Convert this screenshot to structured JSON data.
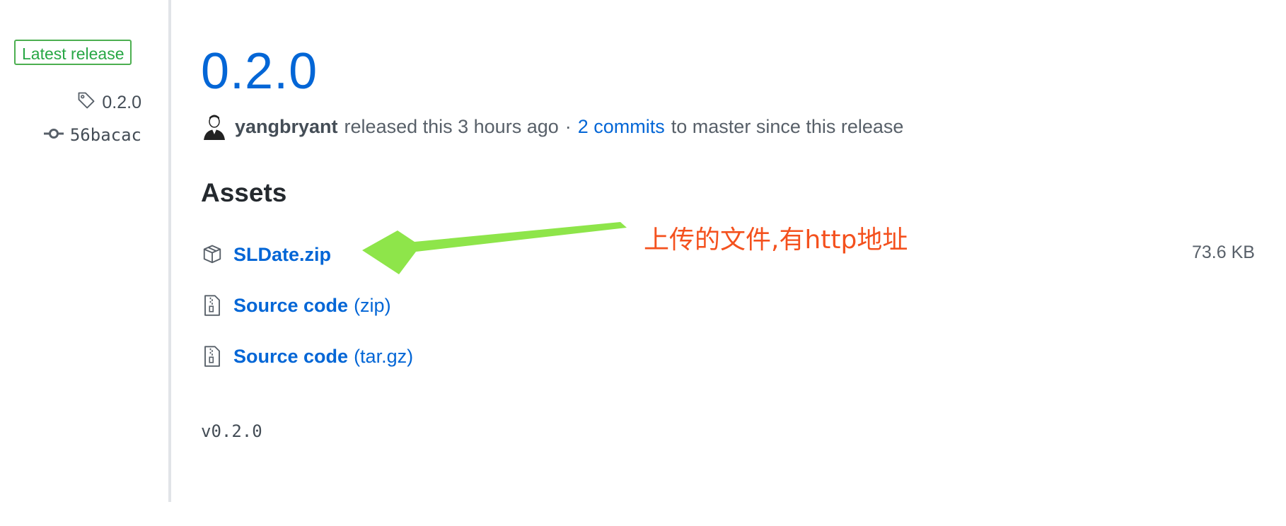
{
  "sidebar": {
    "latest_badge": "Latest release",
    "tag": "0.2.0",
    "commit": "56bacac"
  },
  "release": {
    "title": "0.2.0",
    "author": "yangbryant",
    "released_text": "released this 3 hours ago",
    "separator": "·",
    "commits_link": "2 commits",
    "commits_suffix": "to master since this release"
  },
  "assets": {
    "heading": "Assets",
    "items": [
      {
        "name": "SLDate.zip",
        "suffix": "",
        "size": "73.6 KB",
        "icon": "package-icon"
      },
      {
        "name": "Source code",
        "suffix": "(zip)",
        "icon": "file-zip-icon"
      },
      {
        "name": "Source code",
        "suffix": "(tar.gz)",
        "icon": "file-zip-icon"
      }
    ]
  },
  "tag_body": "v0.2.0",
  "annotation": {
    "text": "上传的文件,有http地址",
    "text_color": "#f4511e",
    "arrow_color": "#8ee54a"
  },
  "colors": {
    "link": "#0366d6",
    "badge": "#28a745",
    "muted": "#586069"
  }
}
